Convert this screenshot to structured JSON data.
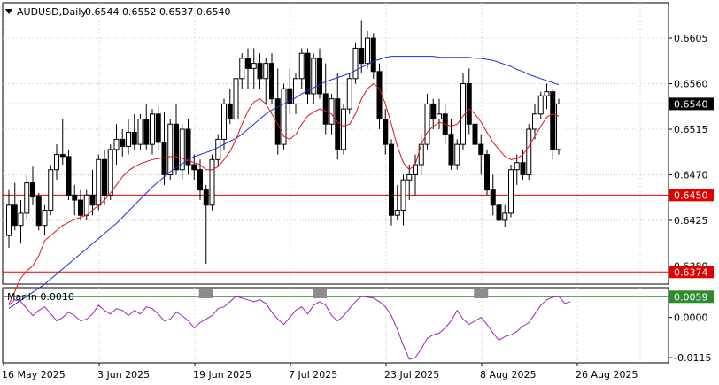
{
  "header": {
    "symbol": "AUDUSD,Daily",
    "ohlc": "0.6544 0.6552 0.6537 0.6540"
  },
  "colors": {
    "background": "#ffffff",
    "grid": "#c8c8c8",
    "candle": "#000000",
    "ma_fast": "#e0141e",
    "ma_slow": "#1a2fd0",
    "level_line": "#e00000",
    "oscillator": "#a020c0",
    "oscillator_level": "#2e8b2e",
    "marker": "#8c8c8c",
    "current_price_tag": "#000000",
    "level_tag": "#e00000",
    "osc_tag": "#2e8b2e"
  },
  "chart_data": [
    {
      "type": "candlestick",
      "title": "AUDUSD,Daily",
      "y_ticks": [
        "0.6605",
        "0.6560",
        "0.6515",
        "0.6470",
        "0.6425",
        "0.6380"
      ],
      "ylim": [
        0.6362,
        0.664
      ],
      "x_ticks": [
        "16 May 2025",
        "3 Jun 2025",
        "19 Jun 2025",
        "7 Jul 2025",
        "23 Jul 2025",
        "8 Aug 2025",
        "26 Aug 2025"
      ],
      "x_tick_index": [
        0,
        16,
        32,
        48,
        64,
        80,
        96
      ],
      "current_price": "0.6540",
      "levels": [
        {
          "value": 0.645,
          "label": "0.6450"
        },
        {
          "value": 0.6374,
          "label": "0.6374"
        }
      ],
      "candles": [
        [
          0.641,
          0.6455,
          0.6398,
          0.644
        ],
        [
          0.644,
          0.6462,
          0.6415,
          0.642
        ],
        [
          0.642,
          0.6445,
          0.6402,
          0.6432
        ],
        [
          0.6432,
          0.647,
          0.6425,
          0.6462
        ],
        [
          0.6462,
          0.6478,
          0.644,
          0.6448
        ],
        [
          0.6448,
          0.6452,
          0.6415,
          0.642
        ],
        [
          0.642,
          0.644,
          0.641,
          0.6435
        ],
        [
          0.6435,
          0.648,
          0.643,
          0.6475
        ],
        [
          0.6475,
          0.65,
          0.6465,
          0.649
        ],
        [
          0.649,
          0.6525,
          0.648,
          0.6488
        ],
        [
          0.6488,
          0.6495,
          0.6445,
          0.645
        ],
        [
          0.645,
          0.646,
          0.643,
          0.6445
        ],
        [
          0.6445,
          0.6455,
          0.6425,
          0.643
        ],
        [
          0.643,
          0.6455,
          0.6425,
          0.645
        ],
        [
          0.645,
          0.6475,
          0.643,
          0.644
        ],
        [
          0.644,
          0.649,
          0.6435,
          0.6485
        ],
        [
          0.6485,
          0.6495,
          0.644,
          0.645
        ],
        [
          0.645,
          0.65,
          0.6445,
          0.6495
        ],
        [
          0.6495,
          0.652,
          0.648,
          0.6505
        ],
        [
          0.6505,
          0.6515,
          0.6488,
          0.6498
        ],
        [
          0.6498,
          0.6525,
          0.649,
          0.6512
        ],
        [
          0.6512,
          0.653,
          0.6495,
          0.65
        ],
        [
          0.65,
          0.653,
          0.6495,
          0.6525
        ],
        [
          0.6525,
          0.654,
          0.6495,
          0.65
        ],
        [
          0.65,
          0.6535,
          0.649,
          0.653
        ],
        [
          0.653,
          0.6538,
          0.6495,
          0.6502
        ],
        [
          0.6502,
          0.6532,
          0.646,
          0.647
        ],
        [
          0.647,
          0.6525,
          0.6465,
          0.652
        ],
        [
          0.652,
          0.654,
          0.647,
          0.6475
        ],
        [
          0.6475,
          0.652,
          0.6465,
          0.6515
        ],
        [
          0.6515,
          0.6525,
          0.647,
          0.648
        ],
        [
          0.648,
          0.649,
          0.6465,
          0.6475
        ],
        [
          0.6475,
          0.6485,
          0.6445,
          0.6455
        ],
        [
          0.6455,
          0.646,
          0.6382,
          0.644
        ],
        [
          0.644,
          0.649,
          0.6435,
          0.6485
        ],
        [
          0.6485,
          0.651,
          0.6478,
          0.6505
        ],
        [
          0.6505,
          0.6545,
          0.6495,
          0.654
        ],
        [
          0.654,
          0.6555,
          0.652,
          0.6525
        ],
        [
          0.6525,
          0.657,
          0.652,
          0.6565
        ],
        [
          0.6565,
          0.659,
          0.6555,
          0.6585
        ],
        [
          0.6585,
          0.6595,
          0.6555,
          0.6575
        ],
        [
          0.6575,
          0.6595,
          0.6555,
          0.658
        ],
        [
          0.658,
          0.659,
          0.6555,
          0.6565
        ],
        [
          0.6565,
          0.6585,
          0.654,
          0.658
        ],
        [
          0.658,
          0.659,
          0.654,
          0.6545
        ],
        [
          0.6545,
          0.6575,
          0.649,
          0.65
        ],
        [
          0.65,
          0.656,
          0.6495,
          0.6555
        ],
        [
          0.6555,
          0.6575,
          0.653,
          0.654
        ],
        [
          0.654,
          0.657,
          0.653,
          0.6565
        ],
        [
          0.6565,
          0.6595,
          0.6555,
          0.659
        ],
        [
          0.659,
          0.6595,
          0.654,
          0.655
        ],
        [
          0.655,
          0.659,
          0.654,
          0.6585
        ],
        [
          0.6585,
          0.6595,
          0.6545,
          0.655
        ],
        [
          0.655,
          0.658,
          0.651,
          0.652
        ],
        [
          0.652,
          0.655,
          0.651,
          0.6545
        ],
        [
          0.6545,
          0.657,
          0.6485,
          0.6495
        ],
        [
          0.6495,
          0.654,
          0.649,
          0.6535
        ],
        [
          0.6535,
          0.657,
          0.653,
          0.6565
        ],
        [
          0.6565,
          0.66,
          0.656,
          0.6595
        ],
        [
          0.6595,
          0.6622,
          0.657,
          0.658
        ],
        [
          0.658,
          0.6612,
          0.6575,
          0.6605
        ],
        [
          0.6605,
          0.661,
          0.6565,
          0.6572
        ],
        [
          0.6572,
          0.658,
          0.6515,
          0.6525
        ],
        [
          0.6525,
          0.6535,
          0.649,
          0.65
        ],
        [
          0.65,
          0.6505,
          0.642,
          0.643
        ],
        [
          0.643,
          0.646,
          0.6425,
          0.6435
        ],
        [
          0.6435,
          0.647,
          0.642,
          0.6465
        ],
        [
          0.6465,
          0.648,
          0.6445,
          0.647
        ],
        [
          0.647,
          0.649,
          0.645,
          0.648
        ],
        [
          0.648,
          0.651,
          0.647,
          0.65
        ],
        [
          0.65,
          0.655,
          0.6495,
          0.654
        ],
        [
          0.654,
          0.6545,
          0.6515,
          0.6525
        ],
        [
          0.6525,
          0.6545,
          0.6515,
          0.653
        ],
        [
          0.653,
          0.654,
          0.65,
          0.651
        ],
        [
          0.651,
          0.6525,
          0.6475,
          0.648
        ],
        [
          0.648,
          0.6505,
          0.6475,
          0.65
        ],
        [
          0.65,
          0.657,
          0.6495,
          0.656
        ],
        [
          0.656,
          0.6575,
          0.651,
          0.652
        ],
        [
          0.652,
          0.653,
          0.649,
          0.65
        ],
        [
          0.65,
          0.651,
          0.647,
          0.649
        ],
        [
          0.649,
          0.6495,
          0.645,
          0.6455
        ],
        [
          0.6455,
          0.647,
          0.643,
          0.644
        ],
        [
          0.644,
          0.6445,
          0.642,
          0.6425
        ],
        [
          0.6425,
          0.644,
          0.6418,
          0.6432
        ],
        [
          0.6432,
          0.648,
          0.6428,
          0.6475
        ],
        [
          0.6475,
          0.649,
          0.646,
          0.6482
        ],
        [
          0.6482,
          0.6495,
          0.6465,
          0.647
        ],
        [
          0.647,
          0.652,
          0.6465,
          0.6515
        ],
        [
          0.6515,
          0.654,
          0.6505,
          0.653
        ],
        [
          0.653,
          0.6552,
          0.6525,
          0.6548
        ],
        [
          0.6548,
          0.656,
          0.6535,
          0.6552
        ],
        [
          0.6552,
          0.6555,
          0.6485,
          0.6495
        ],
        [
          0.6495,
          0.6545,
          0.649,
          0.654
        ]
      ],
      "ma_fast_values": [
        0.6342,
        0.6355,
        0.6368,
        0.6375,
        0.638,
        0.639,
        0.6405,
        0.641,
        0.6415,
        0.642,
        0.6423,
        0.6426,
        0.6428,
        0.643,
        0.6435,
        0.644,
        0.6445,
        0.6452,
        0.646,
        0.6468,
        0.6474,
        0.6478,
        0.6481,
        0.6483,
        0.6485,
        0.6486,
        0.6487,
        0.6488,
        0.6488,
        0.6486,
        0.6484,
        0.6482,
        0.648,
        0.6475,
        0.6475,
        0.6478,
        0.6485,
        0.6493,
        0.6505,
        0.652,
        0.6533,
        0.6542,
        0.6545,
        0.654,
        0.653,
        0.652,
        0.6508,
        0.6505,
        0.651,
        0.652,
        0.6528,
        0.6532,
        0.6535,
        0.6533,
        0.653,
        0.6522,
        0.6518,
        0.652,
        0.653,
        0.6545,
        0.6555,
        0.656,
        0.6555,
        0.654,
        0.652,
        0.6498,
        0.6482,
        0.6475,
        0.648,
        0.65,
        0.6512,
        0.6518,
        0.6522,
        0.652,
        0.6518,
        0.652,
        0.6528,
        0.6535,
        0.653,
        0.6522,
        0.6512,
        0.6502,
        0.6495,
        0.6488,
        0.6485,
        0.6486,
        0.649,
        0.6498,
        0.6508,
        0.6518,
        0.6527,
        0.653,
        0.6528
      ],
      "ma_slow_values": [
        0.6338,
        0.6342,
        0.6346,
        0.635,
        0.6354,
        0.6358,
        0.6362,
        0.6367,
        0.6372,
        0.6377,
        0.6382,
        0.6387,
        0.6392,
        0.6397,
        0.6402,
        0.6407,
        0.6412,
        0.6417,
        0.6422,
        0.6428,
        0.6434,
        0.644,
        0.6446,
        0.6452,
        0.6458,
        0.6463,
        0.6468,
        0.6473,
        0.6477,
        0.6481,
        0.6485,
        0.6488,
        0.649,
        0.6492,
        0.6494,
        0.6497,
        0.65,
        0.6503,
        0.6506,
        0.651,
        0.6515,
        0.652,
        0.6525,
        0.653,
        0.6534,
        0.6537,
        0.654,
        0.6543,
        0.6546,
        0.655,
        0.6553,
        0.6556,
        0.6559,
        0.6562,
        0.6564,
        0.6566,
        0.6568,
        0.657,
        0.6573,
        0.6576,
        0.6579,
        0.6582,
        0.6584,
        0.6586,
        0.6587,
        0.6587,
        0.6587,
        0.6587,
        0.6587,
        0.6587,
        0.6587,
        0.6587,
        0.6586,
        0.6586,
        0.6586,
        0.6586,
        0.6586,
        0.6586,
        0.6585,
        0.6585,
        0.6584,
        0.6583,
        0.6581,
        0.6579,
        0.6577,
        0.6574,
        0.6572,
        0.6569,
        0.6567,
        0.6565,
        0.6563,
        0.6561,
        0.6559
      ]
    },
    {
      "type": "line",
      "title": "Marlin 0.0010",
      "y_ticks": [
        "0.0059",
        "0.0000",
        "-0.0115"
      ],
      "ylim": [
        -0.013,
        0.0085
      ],
      "level": 0.0059,
      "level_label": "0.0059",
      "values": [
        0.0035,
        0.005,
        0.0045,
        0.0025,
        0.0005,
        0.002,
        0.003,
        0.001,
        -0.001,
        0.0,
        0.0015,
        0.0005,
        -0.001,
        -0.0005,
        0.001,
        0.0035,
        0.002,
        0.001,
        0.0025,
        0.002,
        0.0005,
        0.002,
        0.001,
        0.003,
        0.0025,
        0.001,
        -0.001,
        -0.0005,
        0.0015,
        0.0005,
        -0.001,
        -0.003,
        -0.0015,
        -0.0005,
        0.0005,
        0.0025,
        0.003,
        0.0045,
        0.006,
        0.0055,
        0.005,
        0.0045,
        0.005,
        0.004,
        0.0015,
        -0.0005,
        -0.002,
        0.0,
        0.002,
        0.003,
        0.001,
        0.0035,
        0.0045,
        0.0035,
        0.0005,
        -0.001,
        0.0005,
        0.0025,
        0.0045,
        0.006,
        0.0058,
        0.0055,
        0.0045,
        0.003,
        0.0005,
        -0.0035,
        -0.008,
        -0.012,
        -0.0115,
        -0.009,
        -0.006,
        -0.005,
        -0.0045,
        -0.003,
        -0.001,
        0.002,
        -0.0005,
        -0.002,
        -0.001,
        0.0,
        -0.002,
        -0.0045,
        -0.0065,
        -0.0055,
        -0.005,
        -0.004,
        -0.0025,
        -0.0015,
        0.001,
        0.0035,
        0.005,
        0.0058,
        0.006,
        0.004,
        0.0045
      ],
      "markers": [
        33,
        52,
        79
      ]
    }
  ]
}
